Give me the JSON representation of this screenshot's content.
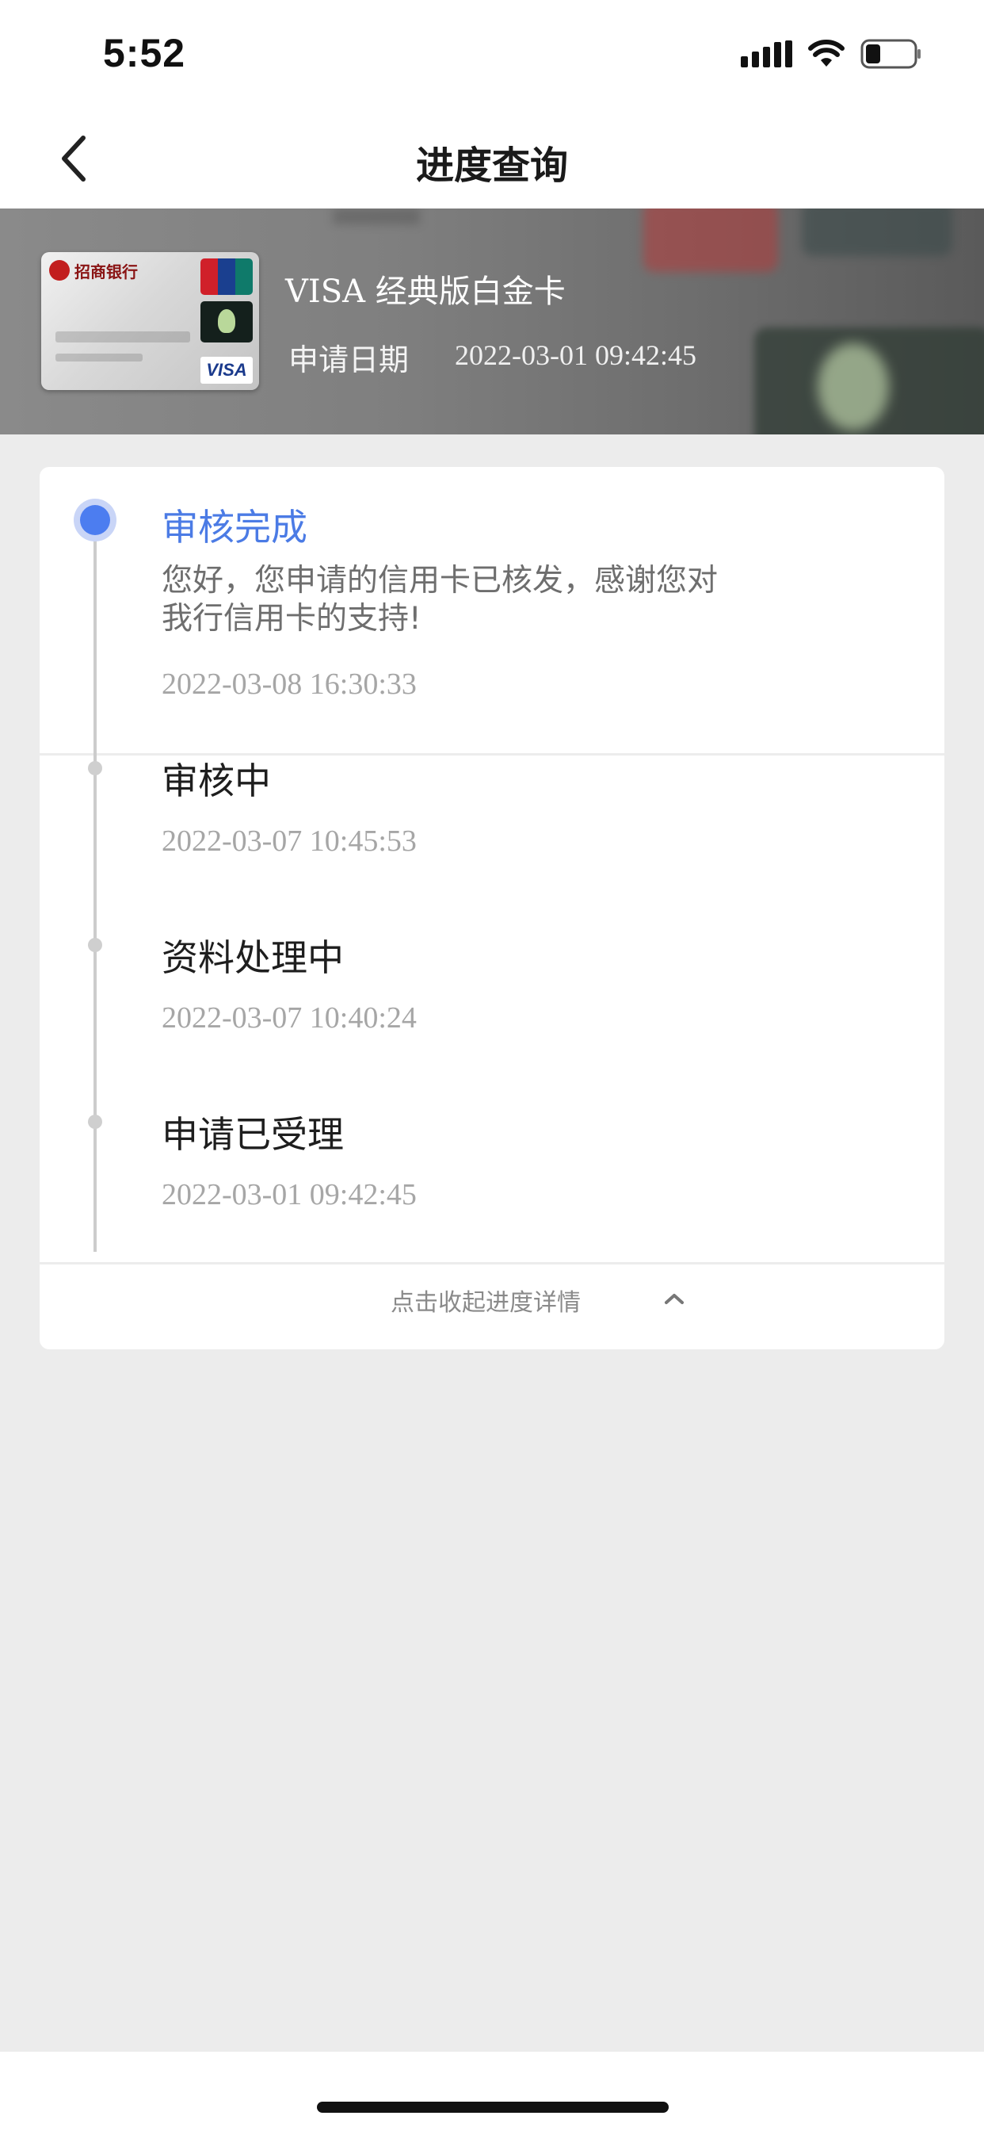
{
  "status_bar": {
    "time": "5:52",
    "icons": [
      "signal-icon",
      "wifi-icon",
      "battery-icon"
    ]
  },
  "nav": {
    "back_icon": "chevron-left-icon",
    "title": "进度查询"
  },
  "card": {
    "product_name": "VISA 经典版白金卡",
    "apply_date_label": "申请日期",
    "apply_date_value": "2022-03-01 09:42:45",
    "bank_name": "招商银行",
    "card_brand": "VISA"
  },
  "progress": {
    "steps": [
      {
        "title": "审核完成",
        "description": "您好，您申请的信用卡已核发，感谢您对我行信用卡的支持!",
        "time": "2022-03-08 16:30:33",
        "status": "current"
      },
      {
        "title": "审核中",
        "time": "2022-03-07 10:45:53",
        "status": "done"
      },
      {
        "title": "资料处理中",
        "time": "2022-03-07 10:40:24",
        "status": "done"
      },
      {
        "title": "申请已受理",
        "time": "2022-03-01 09:42:45",
        "status": "done"
      }
    ],
    "collapse_label": "点击收起进度详情",
    "collapse_icon": "chevron-up-icon"
  },
  "colors": {
    "accent": "#4b7be5",
    "page_background": "#ececec",
    "card_background": "#ffffff"
  }
}
